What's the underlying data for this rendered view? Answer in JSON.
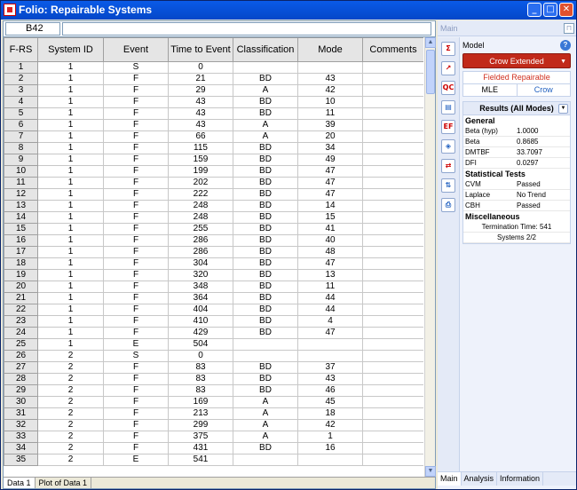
{
  "window": {
    "title": "Folio: Repairable Systems",
    "minimize": "_",
    "maximize": "□",
    "close": "✕"
  },
  "cellref": "B42",
  "columns": [
    "F-RS",
    "System ID",
    "Event",
    "Time to Event",
    "Classification",
    "Mode",
    "Comments"
  ],
  "rows": [
    [
      "1",
      "1",
      "S",
      "0",
      "",
      "",
      ""
    ],
    [
      "2",
      "1",
      "F",
      "21",
      "BD",
      "43",
      ""
    ],
    [
      "3",
      "1",
      "F",
      "29",
      "A",
      "42",
      ""
    ],
    [
      "4",
      "1",
      "F",
      "43",
      "BD",
      "10",
      ""
    ],
    [
      "5",
      "1",
      "F",
      "43",
      "BD",
      "11",
      ""
    ],
    [
      "6",
      "1",
      "F",
      "43",
      "A",
      "39",
      ""
    ],
    [
      "7",
      "1",
      "F",
      "66",
      "A",
      "20",
      ""
    ],
    [
      "8",
      "1",
      "F",
      "115",
      "BD",
      "34",
      ""
    ],
    [
      "9",
      "1",
      "F",
      "159",
      "BD",
      "49",
      ""
    ],
    [
      "10",
      "1",
      "F",
      "199",
      "BD",
      "47",
      ""
    ],
    [
      "11",
      "1",
      "F",
      "202",
      "BD",
      "47",
      ""
    ],
    [
      "12",
      "1",
      "F",
      "222",
      "BD",
      "47",
      ""
    ],
    [
      "13",
      "1",
      "F",
      "248",
      "BD",
      "14",
      ""
    ],
    [
      "14",
      "1",
      "F",
      "248",
      "BD",
      "15",
      ""
    ],
    [
      "15",
      "1",
      "F",
      "255",
      "BD",
      "41",
      ""
    ],
    [
      "16",
      "1",
      "F",
      "286",
      "BD",
      "40",
      ""
    ],
    [
      "17",
      "1",
      "F",
      "286",
      "BD",
      "48",
      ""
    ],
    [
      "18",
      "1",
      "F",
      "304",
      "BD",
      "47",
      ""
    ],
    [
      "19",
      "1",
      "F",
      "320",
      "BD",
      "13",
      ""
    ],
    [
      "20",
      "1",
      "F",
      "348",
      "BD",
      "11",
      ""
    ],
    [
      "21",
      "1",
      "F",
      "364",
      "BD",
      "44",
      ""
    ],
    [
      "22",
      "1",
      "F",
      "404",
      "BD",
      "44",
      ""
    ],
    [
      "23",
      "1",
      "F",
      "410",
      "BD",
      "4",
      ""
    ],
    [
      "24",
      "1",
      "F",
      "429",
      "BD",
      "47",
      ""
    ],
    [
      "25",
      "1",
      "E",
      "504",
      "",
      "",
      ""
    ],
    [
      "26",
      "2",
      "S",
      "0",
      "",
      "",
      ""
    ],
    [
      "27",
      "2",
      "F",
      "83",
      "BD",
      "37",
      ""
    ],
    [
      "28",
      "2",
      "F",
      "83",
      "BD",
      "43",
      ""
    ],
    [
      "29",
      "2",
      "F",
      "83",
      "BD",
      "46",
      ""
    ],
    [
      "30",
      "2",
      "F",
      "169",
      "A",
      "45",
      ""
    ],
    [
      "31",
      "2",
      "F",
      "213",
      "A",
      "18",
      ""
    ],
    [
      "32",
      "2",
      "F",
      "299",
      "A",
      "42",
      ""
    ],
    [
      "33",
      "2",
      "F",
      "375",
      "A",
      "1",
      ""
    ],
    [
      "34",
      "2",
      "F",
      "431",
      "BD",
      "16",
      ""
    ],
    [
      "35",
      "2",
      "E",
      "541",
      "",
      "",
      ""
    ]
  ],
  "sheet_tabs": [
    "Data 1",
    "Plot of Data 1"
  ],
  "side": {
    "header": "Main",
    "pin": "⊓",
    "model_label": "Model",
    "help": "?",
    "model_button": "Crow Extended",
    "data_type": "Fielded Repairable",
    "method_left": "MLE",
    "method_right": "Crow",
    "results_title": "Results (All Modes)",
    "general_title": "General",
    "general": [
      {
        "k": "Beta (hyp)",
        "v": "1.0000"
      },
      {
        "k": "Beta",
        "v": "0.8685"
      },
      {
        "k": "DMTBF",
        "v": "33.7097"
      },
      {
        "k": "DFI",
        "v": "0.0297"
      }
    ],
    "tests_title": "Statistical Tests",
    "tests": [
      {
        "k": "CVM",
        "v": "Passed"
      },
      {
        "k": "Laplace",
        "v": "No Trend"
      },
      {
        "k": "CBH",
        "v": "Passed"
      }
    ],
    "misc_title": "Miscellaneous",
    "misc": [
      "Termination Time: 541",
      "Systems 2/2"
    ],
    "bottom_tabs": [
      "Main",
      "Analysis",
      "Information"
    ]
  },
  "tools": [
    {
      "name": "calculate-icon",
      "glyph": "Σ",
      "color": "red"
    },
    {
      "name": "plot-icon",
      "glyph": "↗",
      "color": "red"
    },
    {
      "name": "qcp-icon",
      "glyph": "QC",
      "color": "red"
    },
    {
      "name": "report-icon",
      "glyph": "▤",
      "color": "blue"
    },
    {
      "name": "effectiveness-icon",
      "glyph": "EF",
      "color": "red"
    },
    {
      "name": "navigate-icon",
      "glyph": "◈",
      "color": "blue"
    },
    {
      "name": "transfer-icon",
      "glyph": "⇄",
      "color": "red"
    },
    {
      "name": "sort-icon",
      "glyph": "⇅",
      "color": "blue"
    },
    {
      "name": "print-icon",
      "glyph": "⎙",
      "color": "blue"
    }
  ]
}
